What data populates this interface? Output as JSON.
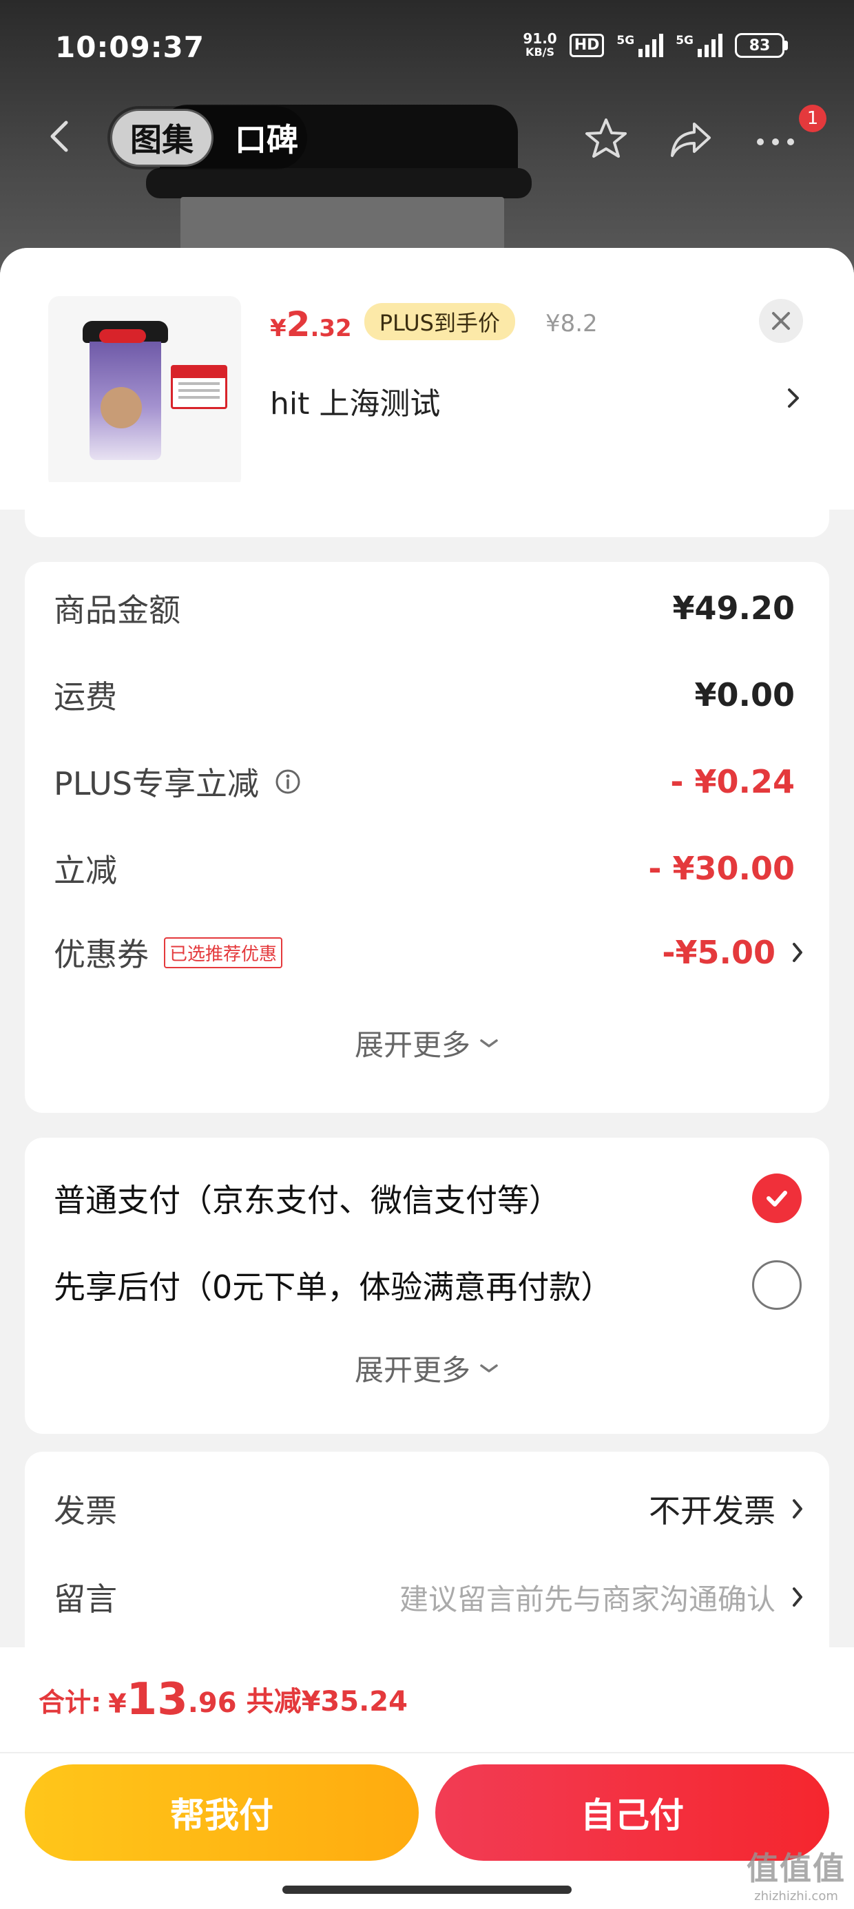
{
  "status_bar": {
    "time": "10:09:37",
    "net_speed_value": "91.0",
    "net_speed_unit": "KB/S",
    "hd_label": "HD",
    "signal_1_label": "5G",
    "signal_2_label": "5G",
    "battery": "83"
  },
  "nav": {
    "tab_gallery": "图集",
    "tab_reviews": "口碑",
    "badge_count": "1",
    "icons": [
      "back-icon",
      "star-icon",
      "share-icon",
      "more-icon"
    ]
  },
  "product": {
    "price_currency": "¥",
    "price_int": "2",
    "price_dec": ".32",
    "plus_tag": "PLUS到手价",
    "original_price": "¥8.2",
    "name": "hit  上海测试"
  },
  "amounts": {
    "goods_label": "商品金额",
    "goods_value": "¥49.20",
    "shipping_label": "运费",
    "shipping_value": "¥0.00",
    "plus_discount_label": "PLUS专享立减",
    "plus_discount_value": "- ¥0.24",
    "instant_discount_label": "立减",
    "instant_discount_value": "- ¥30.00",
    "coupon_label": "优惠券",
    "coupon_tag": "已选推荐优惠",
    "coupon_value": "-¥5.00",
    "expand_more": "展开更多"
  },
  "payment": {
    "option_normal": "普通支付（京东支付、微信支付等）",
    "option_normal_selected": true,
    "option_later": "先享后付（0元下单，体验满意再付款）",
    "option_later_selected": false,
    "expand_more": "展开更多"
  },
  "misc": {
    "invoice_label": "发票",
    "invoice_value": "不开发票",
    "message_label": "留言",
    "message_placeholder": "建议留言前先与商家沟通确认"
  },
  "footer": {
    "total_label": "合计:",
    "total_currency": "¥",
    "total_int": "13",
    "total_dec": ".96",
    "total_saved": "共减¥35.24",
    "help_pay_button": "帮我付",
    "self_pay_button": "自己付"
  },
  "watermark": {
    "line1": "值值值",
    "line2": "zhizhizhi.com"
  },
  "colors": {
    "accent_red": "#e4393c",
    "plus_tag_bg": "#fce9a8",
    "help_button": "#ffb914",
    "self_button": "#f2303f"
  }
}
